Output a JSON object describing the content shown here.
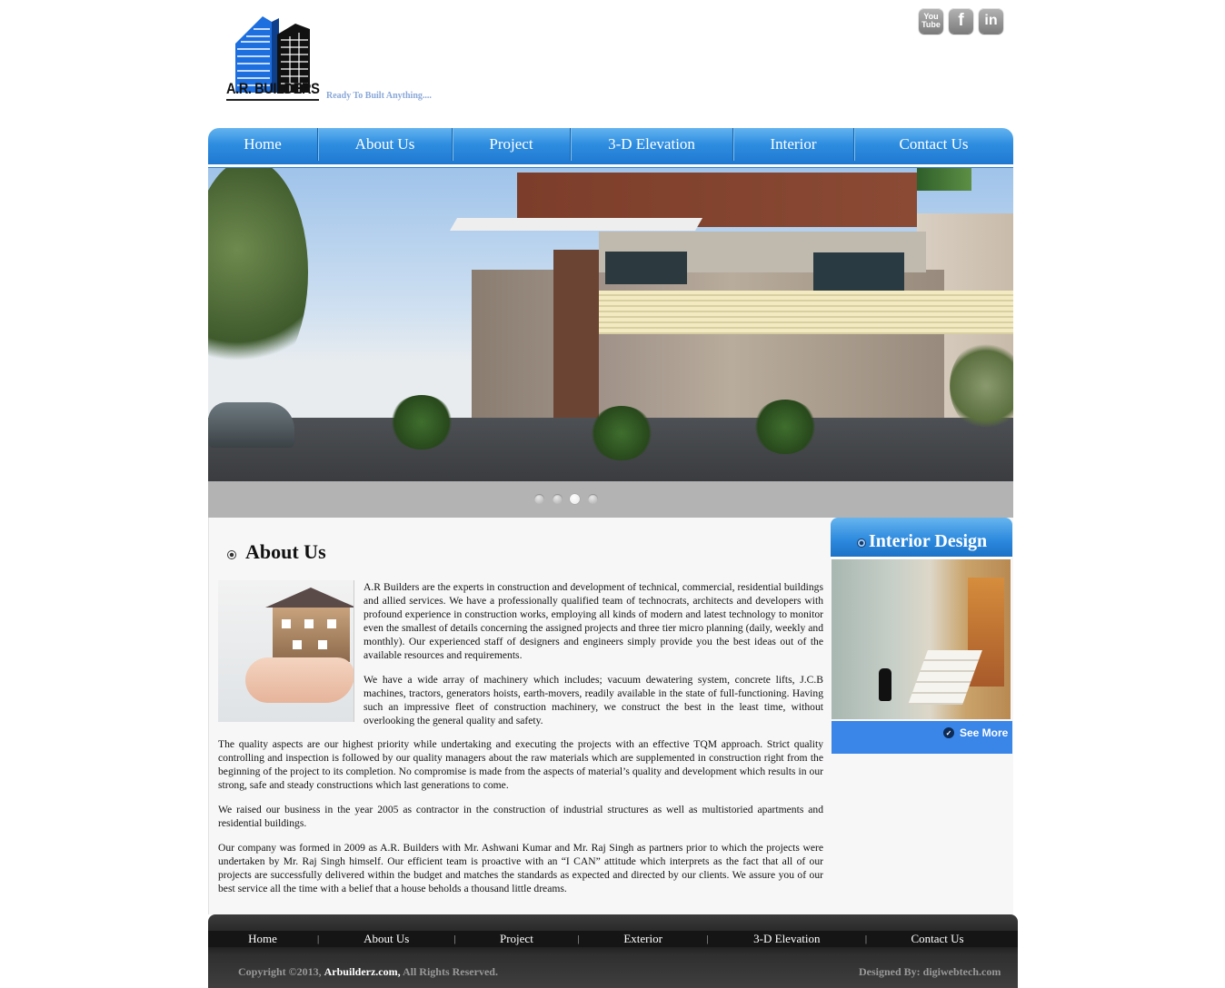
{
  "header": {
    "logo_text": "A.R. BUILDERS",
    "tagline": "Ready To Built Anything....",
    "social": [
      {
        "name": "youtube",
        "label_top": "You",
        "label_bottom": "Tube"
      },
      {
        "name": "facebook",
        "label": "f"
      },
      {
        "name": "linkedin",
        "label": "in"
      }
    ]
  },
  "nav": {
    "items": [
      "Home",
      "About Us",
      "Project",
      "3-D Elevation",
      "Interior",
      "Contact Us"
    ]
  },
  "slider": {
    "dots": 4,
    "active_dot": 3
  },
  "about": {
    "title": "About Us",
    "paragraphs": [
      "A.R Builders are the experts in construction and development of technical, commercial, residential buildings and allied services. We have a professionally qualified team of technocrats, architects and developers with profound experience in construction works, employing all kinds of modern and latest technology to monitor even the smallest of details concerning the assigned projects and three tier micro planning (daily, weekly and monthly). Our experienced staff of designers and engineers simply provide you the best ideas out of the available resources and requirements.",
      "We have a wide array of machinery which includes; vacuum dewatering system, concrete lifts, J.C.B machines, tractors, generators hoists, earth-movers, readily available in the state of full-functioning. Having such an impressive fleet of construction machinery, we construct the best in the least time, without overlooking the general quality and safety.",
      "The quality aspects are our highest priority while undertaking and executing the projects with an effective TQM approach. Strict quality controlling and inspection is followed by our quality managers about the raw materials which are supplemented in construction right from the beginning of the project to its completion. No compromise is made from the aspects of material’s quality and development which results in our strong, safe and steady constructions which last generations to come.",
      "We raised our business in the year 2005 as contractor in the construction of industrial structures as well as multistoried apartments and residential buildings.",
      "Our company was formed in 2009 as A.R. Builders with Mr. Ashwani Kumar and Mr. Raj Singh as partners prior to which the projects were undertaken by Mr. Raj Singh himself. Our efficient team is proactive with an “I CAN” attitude which interprets as the fact that all of our projects are successfully delivered within the budget and matches the standards as expected and directed by our clients. We assure you of our best service all the time with a belief that a house beholds a thousand little dreams."
    ]
  },
  "sidebar": {
    "title": "Interior Design",
    "see_more": "See More"
  },
  "footer": {
    "nav": [
      "Home",
      "About Us",
      "Project",
      "Exterior",
      "3-D Elevation",
      "Contact Us"
    ],
    "copyright_prefix": "Copyright ©2013,",
    "copyright_site": "Arbuilderz.com,",
    "copyright_suffix": "All Rights Reserved.",
    "designed_by": "Designed By: digiwebtech.com"
  },
  "colors": {
    "nav_blue": "#2e8de0",
    "sidebar_blue": "#3a86e8",
    "tagline": "#8aa8d8",
    "footer_dark": "#1c1c1c"
  }
}
